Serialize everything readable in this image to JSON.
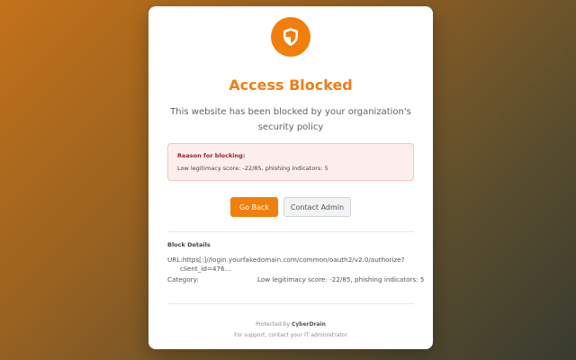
{
  "header": {
    "title": "Access Blocked",
    "subtitle": "This website has been blocked by your organization's security policy"
  },
  "reason": {
    "title": "Reason for blocking:",
    "text": "Low legitimacy score: -22/85, phishing indicators: 5"
  },
  "buttons": {
    "back_label": "Go Back",
    "contact_label": "Contact Admin"
  },
  "details": {
    "title": "Block Details",
    "url_label": "URL:",
    "url_value_line1": "https[:]//login.yourfakedomain.com/common/oauth2/v2.0/authorize?",
    "url_value_line2": "client_id=476...",
    "category_label": "Category:",
    "category_value": "Low legitimacy score: -22/85, phishing indicators: 5"
  },
  "footer": {
    "protected_prefix": "Protected by ",
    "brand": "CyberDrain",
    "support": "For support, contact your IT administrator"
  },
  "colors": {
    "accent": "#f07f0b",
    "title": "#ef7d12",
    "alert_bg": "#fdeeee",
    "alert_border": "#f3c3c3",
    "alert_title": "#9b1c1c"
  },
  "icons": {
    "header": "shield-icon"
  }
}
